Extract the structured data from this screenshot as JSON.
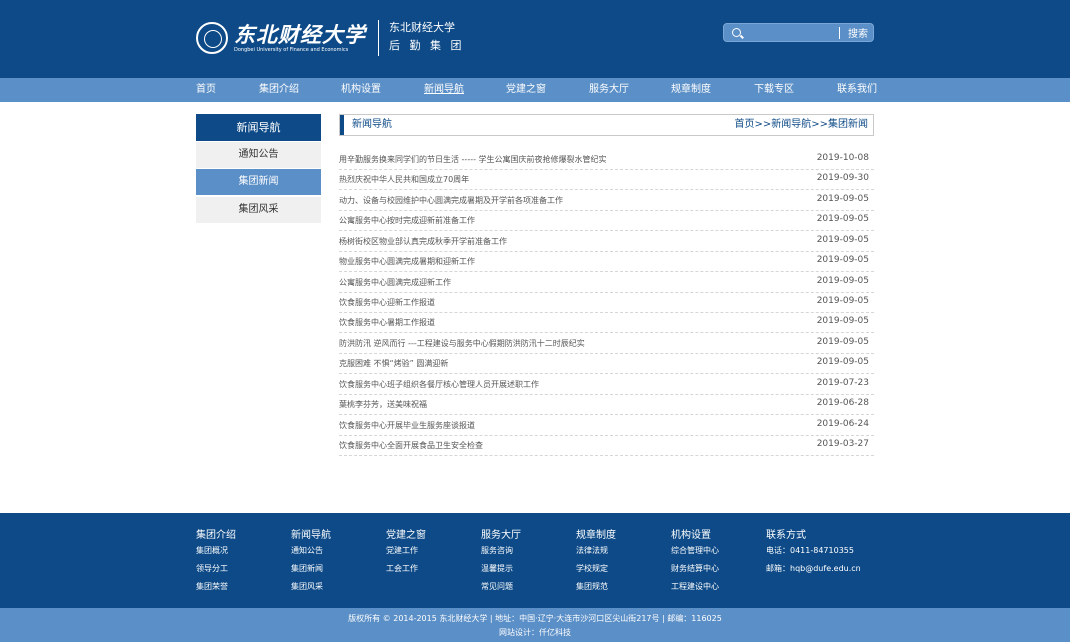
{
  "header": {
    "logo_cn": "东北财经大学",
    "logo_en": "Dongbei University of Finance and Economics",
    "sub_line1": "东北财经大学",
    "sub_line2": "后 勤 集 团"
  },
  "search": {
    "placeholder": "",
    "button_label": "搜索"
  },
  "nav": [
    {
      "label": "首页",
      "active": false
    },
    {
      "label": "集团介绍",
      "active": false
    },
    {
      "label": "机构设置",
      "active": false
    },
    {
      "label": "新闻导航",
      "active": true
    },
    {
      "label": "党建之窗",
      "active": false
    },
    {
      "label": "服务大厅",
      "active": false
    },
    {
      "label": "规章制度",
      "active": false
    },
    {
      "label": "下载专区",
      "active": false
    },
    {
      "label": "联系我们",
      "active": false
    }
  ],
  "sidebar": {
    "title": "新闻导航",
    "items": [
      {
        "label": "通知公告",
        "active": false
      },
      {
        "label": "集团新闻",
        "active": true
      },
      {
        "label": "集团风采",
        "active": false
      }
    ]
  },
  "content": {
    "title": "新闻导航",
    "breadcrumb": "首页>>新闻导航>>集团新闻"
  },
  "news": [
    {
      "title": "用辛勤服务换来同学们的节日生活 ----- 学生公寓国庆前夜抢修爆裂水管纪实",
      "date": "2019-10-08"
    },
    {
      "title": "热烈庆祝中华人民共和国成立70周年",
      "date": "2019-09-30"
    },
    {
      "title": "动力、设备与校园维护中心圆满完成暑期及开学前各项准备工作",
      "date": "2019-09-05"
    },
    {
      "title": "公寓服务中心按时完成迎新前准备工作",
      "date": "2019-09-05"
    },
    {
      "title": "杨树街校区物业部认真完成秋季开学前准备工作",
      "date": "2019-09-05"
    },
    {
      "title": "物业服务中心圆满完成暑期和迎新工作",
      "date": "2019-09-05"
    },
    {
      "title": "公寓服务中心圆满完成迎新工作",
      "date": "2019-09-05"
    },
    {
      "title": "饮食服务中心迎新工作报道",
      "date": "2019-09-05"
    },
    {
      "title": "饮食服务中心暑期工作报道",
      "date": "2019-09-05"
    },
    {
      "title": "防洪防汛 逆风而行 ---工程建设与服务中心假期防洪防汛十二时辰纪实",
      "date": "2019-09-05"
    },
    {
      "title": "克服困难 不惧“烤验” 圆满迎新",
      "date": "2019-09-05"
    },
    {
      "title": "饮食服务中心班子组织各餐厅核心管理人员开展述职工作",
      "date": "2019-07-23"
    },
    {
      "title": "葉桃李芬芳，送美味祝福",
      "date": "2019-06-28"
    },
    {
      "title": "饮食服务中心开展毕业生服务座谈报道",
      "date": "2019-06-24"
    },
    {
      "title": "饮食服务中心全面开展食品卫生安全检查",
      "date": "2019-03-27"
    }
  ],
  "footer": {
    "columns": [
      {
        "heading": "集团介绍",
        "links": [
          "集团概况",
          "领导分工",
          "集团荣誉"
        ]
      },
      {
        "heading": "新闻导航",
        "links": [
          "通知公告",
          "集团新闻",
          "集团风采"
        ]
      },
      {
        "heading": "党建之窗",
        "links": [
          "党建工作",
          "工会工作"
        ]
      },
      {
        "heading": "服务大厅",
        "links": [
          "服务咨询",
          "温馨提示",
          "常见问题"
        ]
      },
      {
        "heading": "规章制度",
        "links": [
          "法律法规",
          "学校规定",
          "集团规范"
        ]
      },
      {
        "heading": "机构设置",
        "links": [
          "综合管理中心",
          "财务结算中心",
          "工程建设中心"
        ]
      },
      {
        "heading": "联系方式",
        "links": [
          "电话：0411-84710355",
          "邮箱：hqb@dufe.edu.cn"
        ]
      }
    ],
    "copyright": "版权所有 © 2014-2015 东北财经大学 | 地址：中国·辽宁·大连市沙河口区尖山街217号 | 邮编：116025",
    "design": "网站设计：仟亿科技"
  }
}
